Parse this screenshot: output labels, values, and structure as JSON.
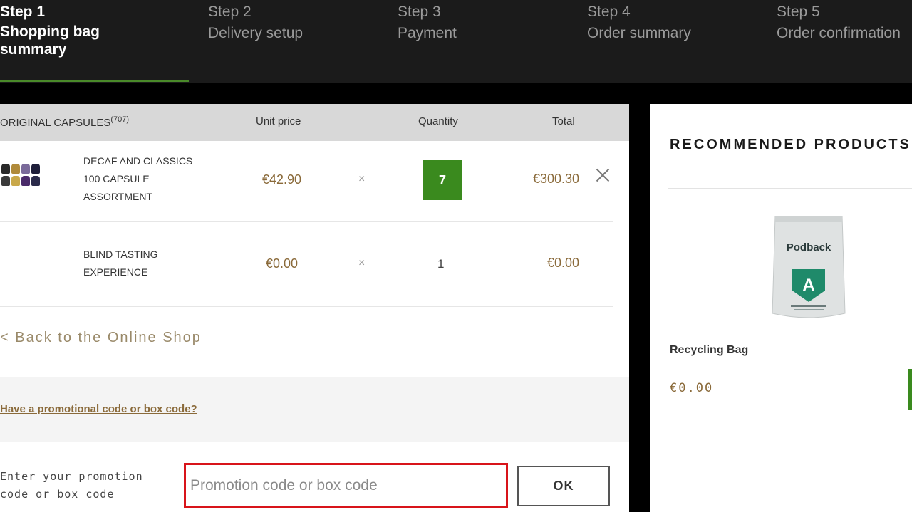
{
  "steps": [
    {
      "num": "Step 1",
      "label": "Shopping bag summary",
      "active": true
    },
    {
      "num": "Step 2",
      "label": "Delivery setup",
      "active": false
    },
    {
      "num": "Step 3",
      "label": "Payment",
      "active": false
    },
    {
      "num": "Step 4",
      "label": "Order summary",
      "active": false
    },
    {
      "num": "Step 5",
      "label": "Order confirmation",
      "active": false
    }
  ],
  "cart": {
    "section_title": "ORIGINAL CAPSULES",
    "section_count": "(707)",
    "col_unit_price": "Unit price",
    "col_quantity": "Quantity",
    "col_total": "Total",
    "items": [
      {
        "name_line1": "DECAF AND CLASSICS",
        "name_line2": "100 CAPSULE",
        "name_line3": "ASSORTMENT",
        "unit_price": "€42.90",
        "times": "×",
        "quantity": "7",
        "total": "€300.30"
      },
      {
        "name_line1": "BLIND TASTING",
        "name_line2": "EXPERIENCE",
        "unit_price": "€0.00",
        "times": "×",
        "quantity": "1",
        "total": "€0.00"
      }
    ],
    "back_link": "< Back to the Online Shop",
    "promo_link": "Have a promotional code or box code?",
    "promo_label": "Enter your promotion code or box code",
    "promo_placeholder": "Promotion code or box code",
    "ok_label": "OK"
  },
  "recommended": {
    "title": "RECOMMENDED PRODUCTS",
    "product_name": "Recycling Bag",
    "product_price": "€0.00",
    "bag_brand": "Podback",
    "bag_letter": "A"
  },
  "colors": {
    "accent_green": "#3a8a1e",
    "price_gold": "#8a6a3a",
    "error_red": "#d8141a"
  }
}
